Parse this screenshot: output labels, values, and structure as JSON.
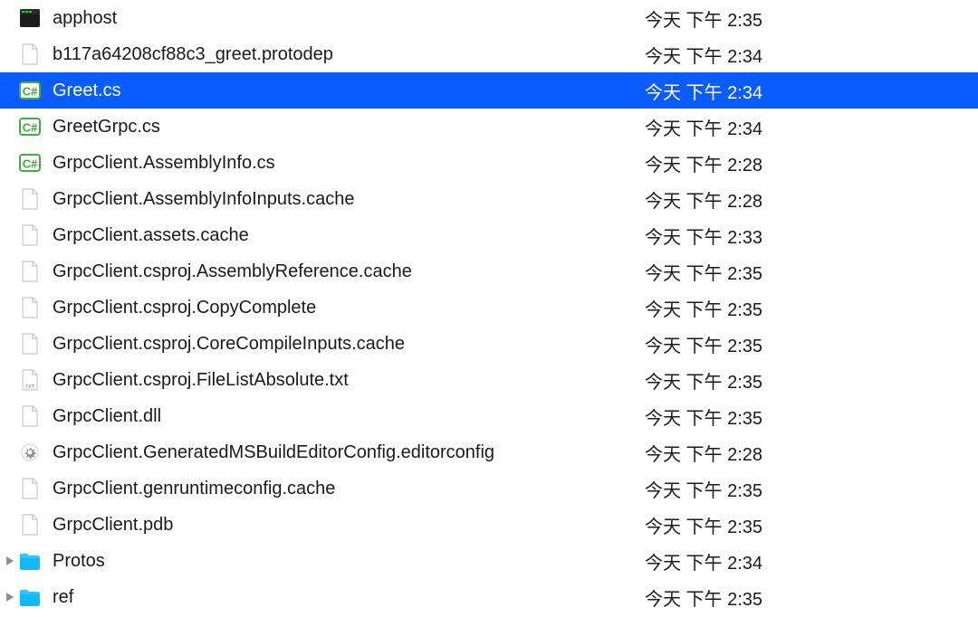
{
  "files": [
    {
      "name": "apphost",
      "date": "今天 下午 2:35",
      "icon": "exec",
      "selected": false,
      "folder": false
    },
    {
      "name": "b117a64208cf88c3_greet.protodep",
      "date": "今天 下午 2:34",
      "icon": "blank",
      "selected": false,
      "folder": false
    },
    {
      "name": "Greet.cs",
      "date": "今天 下午 2:34",
      "icon": "csharp",
      "selected": true,
      "folder": false
    },
    {
      "name": "GreetGrpc.cs",
      "date": "今天 下午 2:34",
      "icon": "csharp",
      "selected": false,
      "folder": false
    },
    {
      "name": "GrpcClient.AssemblyInfo.cs",
      "date": "今天 下午 2:28",
      "icon": "csharp",
      "selected": false,
      "folder": false
    },
    {
      "name": "GrpcClient.AssemblyInfoInputs.cache",
      "date": "今天 下午 2:28",
      "icon": "blank",
      "selected": false,
      "folder": false
    },
    {
      "name": "GrpcClient.assets.cache",
      "date": "今天 下午 2:33",
      "icon": "blank",
      "selected": false,
      "folder": false
    },
    {
      "name": "GrpcClient.csproj.AssemblyReference.cache",
      "date": "今天 下午 2:35",
      "icon": "blank",
      "selected": false,
      "folder": false
    },
    {
      "name": "GrpcClient.csproj.CopyComplete",
      "date": "今天 下午 2:35",
      "icon": "blank",
      "selected": false,
      "folder": false
    },
    {
      "name": "GrpcClient.csproj.CoreCompileInputs.cache",
      "date": "今天 下午 2:35",
      "icon": "blank",
      "selected": false,
      "folder": false
    },
    {
      "name": "GrpcClient.csproj.FileListAbsolute.txt",
      "date": "今天 下午 2:35",
      "icon": "txt",
      "selected": false,
      "folder": false
    },
    {
      "name": "GrpcClient.dll",
      "date": "今天 下午 2:35",
      "icon": "blank",
      "selected": false,
      "folder": false
    },
    {
      "name": "GrpcClient.GeneratedMSBuildEditorConfig.editorconfig",
      "date": "今天 下午 2:28",
      "icon": "gear",
      "selected": false,
      "folder": false
    },
    {
      "name": "GrpcClient.genruntimeconfig.cache",
      "date": "今天 下午 2:35",
      "icon": "blank",
      "selected": false,
      "folder": false
    },
    {
      "name": "GrpcClient.pdb",
      "date": "今天 下午 2:35",
      "icon": "blank",
      "selected": false,
      "folder": false
    },
    {
      "name": "Protos",
      "date": "今天 下午 2:34",
      "icon": "folder",
      "selected": false,
      "folder": true
    },
    {
      "name": "ref",
      "date": "今天 下午 2:35",
      "icon": "folder",
      "selected": false,
      "folder": true
    }
  ]
}
